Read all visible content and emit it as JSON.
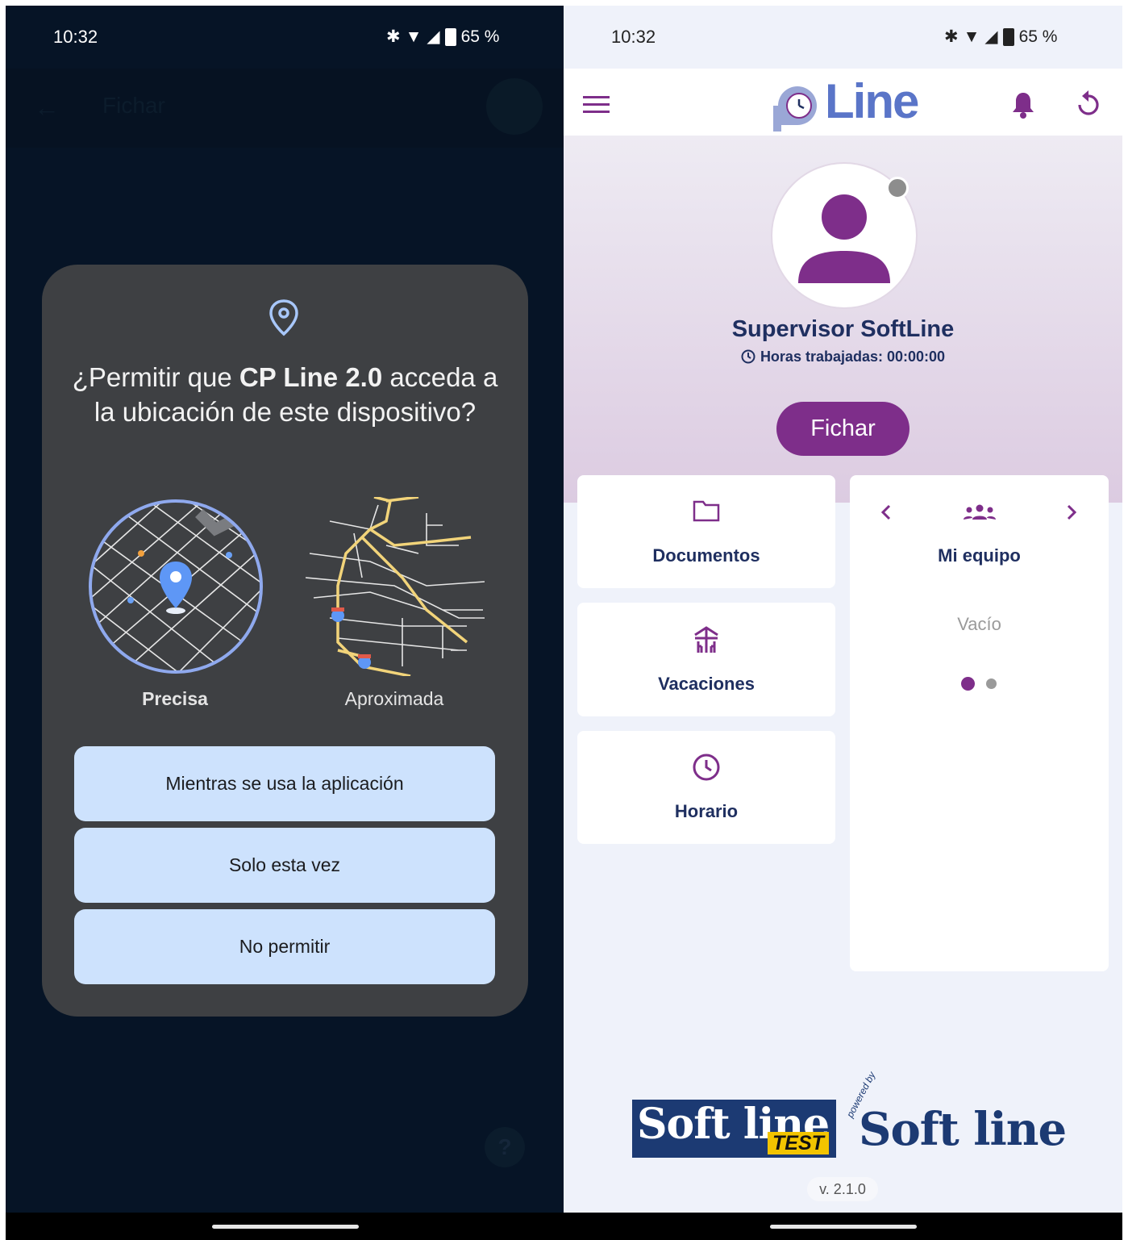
{
  "left_screen": {
    "status_bar": {
      "time": "10:32",
      "battery": "65 %"
    },
    "dialog": {
      "title_prefix": "¿Permitir que ",
      "app_name": "CP Line 2.0",
      "title_suffix": " acceda a la ubicación de este dispositivo?",
      "options": {
        "precise_label": "Precisa",
        "approximate_label": "Aproximada",
        "selected": "Precisa"
      },
      "buttons": {
        "while_using": "Mientras se usa la aplicación",
        "only_once": "Solo esta vez",
        "deny": "No permitir"
      }
    },
    "background": {
      "title": "Fichar"
    }
  },
  "right_screen": {
    "status_bar": {
      "time": "10:32",
      "battery": "65 %"
    },
    "header": {
      "logo_text": "Line",
      "icons": [
        "menu-icon",
        "bell-icon",
        "refresh-icon"
      ]
    },
    "profile": {
      "name": "Supervisor SoftLine",
      "hours_label": "Horas trabajadas: 00:00:00"
    },
    "fichar_button": "Fichar",
    "tiles": [
      {
        "label": "Documentos",
        "icon": "folder-icon"
      },
      {
        "label": "Vacaciones",
        "icon": "beach-icon"
      },
      {
        "label": "Horario",
        "icon": "clock-icon"
      }
    ],
    "team_card": {
      "title": "Mi equipo",
      "empty_text": "Vacío",
      "pages": 2,
      "active_page": 1
    },
    "footer": {
      "logo1": "Soft line",
      "logo1_badge": "TEST",
      "powered_by": "powered by",
      "logo2": "Soft line",
      "version": "v. 2.1.0"
    },
    "colors": {
      "primary": "#7e2e8a",
      "navy": "#1f2f60"
    }
  }
}
